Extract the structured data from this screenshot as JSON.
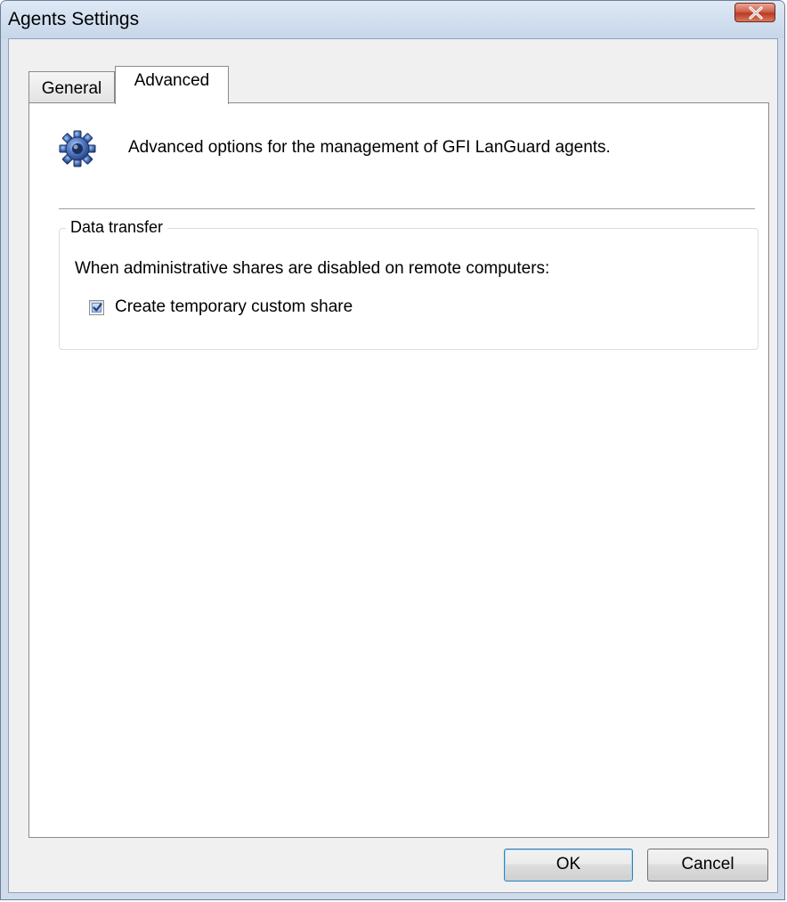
{
  "window": {
    "title": "Agents Settings"
  },
  "tabs": [
    {
      "label": "General",
      "selected": false
    },
    {
      "label": "Advanced",
      "selected": true
    }
  ],
  "header": {
    "icon": "gear-icon",
    "text": "Advanced options for the management of GFI LanGuard agents."
  },
  "data_transfer": {
    "legend": "Data transfer",
    "description": "When administrative shares are disabled on remote computers:",
    "checkbox_label": "Create temporary custom share",
    "checked": true
  },
  "buttons": {
    "ok": "OK",
    "cancel": "Cancel"
  },
  "colors": {
    "titlebar": "#c6d6ea",
    "close_button": "#c74a33",
    "page_background": "#ffffff",
    "window_background": "#f0f0f0",
    "default_button_border": "#3c7fb1"
  }
}
